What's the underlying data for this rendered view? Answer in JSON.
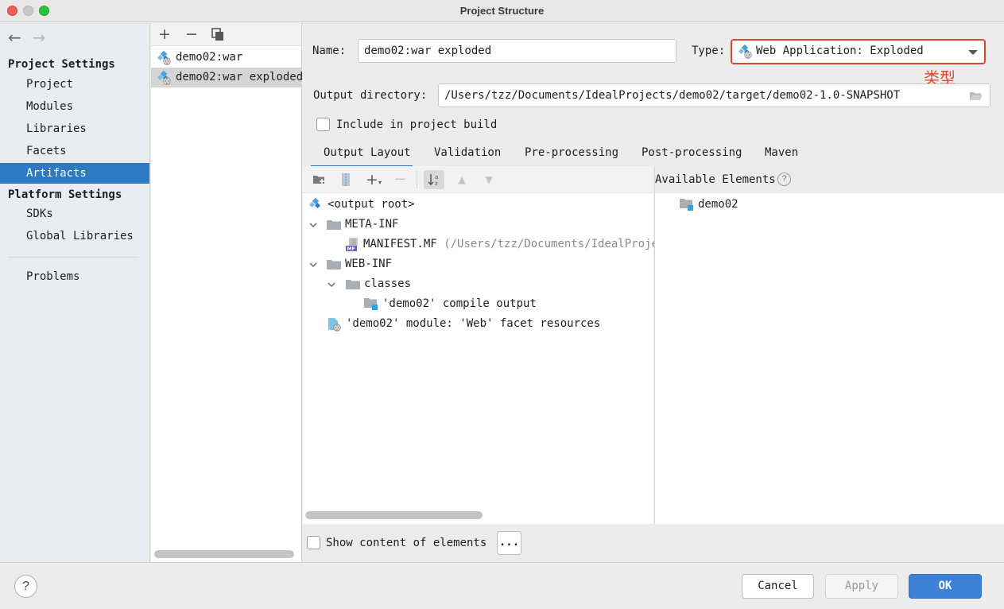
{
  "window": {
    "title": "Project Structure"
  },
  "nav": {
    "back": "←",
    "forward": "→",
    "project_settings_header": "Project Settings",
    "project_settings_items": [
      "Project",
      "Modules",
      "Libraries",
      "Facets",
      "Artifacts"
    ],
    "selected": "Artifacts",
    "platform_settings_header": "Platform Settings",
    "platform_settings_items": [
      "SDKs",
      "Global Libraries"
    ],
    "problems": "Problems"
  },
  "artifacts": {
    "toolbar": {
      "add": "+",
      "remove": "−",
      "copy": "copy-icon"
    },
    "items": [
      "demo02:war",
      "demo02:war exploded"
    ],
    "selected": "demo02:war exploded"
  },
  "form": {
    "name_label": "Name:",
    "name_value": "demo02:war exploded",
    "type_label": "Type:",
    "type_value": "Web Application: Exploded",
    "type_annotation": "类型",
    "output_dir_label": "Output directory:",
    "output_dir_value": "/Users/tzz/Documents/IdealProjects/demo02/target/demo02-1.0-SNAPSHOT",
    "include_label": "Include in project build",
    "include_checked": false
  },
  "tabs": [
    "Output Layout",
    "Validation",
    "Pre-processing",
    "Post-processing",
    "Maven"
  ],
  "active_tab": "Output Layout",
  "layout_tree": {
    "root": "<output root>",
    "meta_inf": "META-INF",
    "manifest": "MANIFEST.MF",
    "manifest_path": "(/Users/tzz/Documents/IdealProje",
    "web_inf": "WEB-INF",
    "classes": "classes",
    "compile_output": "'demo02' compile output",
    "web_facet": "'demo02' module: 'Web' facet resources"
  },
  "available": {
    "header": "Available Elements",
    "help": "?",
    "items": [
      "demo02"
    ]
  },
  "show_content": {
    "label": "Show content of elements",
    "checked": false,
    "more": "..."
  },
  "buttons": {
    "help": "?",
    "cancel": "Cancel",
    "apply": "Apply",
    "ok": "OK"
  },
  "colors": {
    "accent": "#2e7ac2",
    "annotation": "#e0462f",
    "ok": "#3b82d6"
  }
}
